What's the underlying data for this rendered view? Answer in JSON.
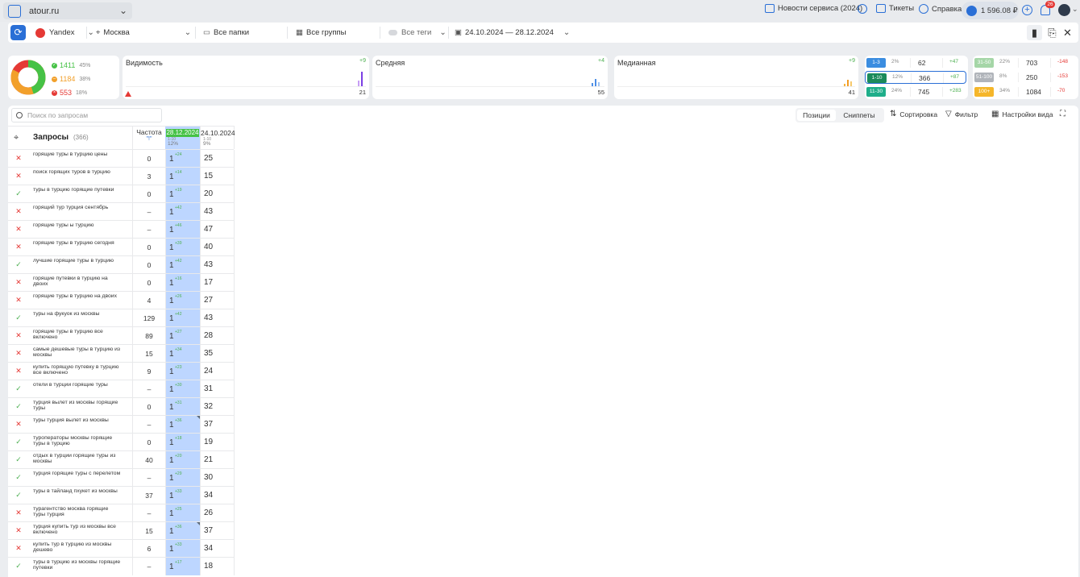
{
  "topbar": {
    "project": "atour.ru",
    "news": "Новости сервиса (2024)",
    "tickets": "Тикеты",
    "help": "Справка",
    "balance": "1 596.08 ₽",
    "notifications": "26"
  },
  "filters": {
    "engine": "Yandex",
    "region": "Москва",
    "folders": "Все папки",
    "groups": "Все группы",
    "tags": "Все теги",
    "dates": "24.10.2024 — 28.12.2024"
  },
  "summary": {
    "top": {
      "count": "1411",
      "pct": "45%"
    },
    "mid": {
      "count": "1184",
      "pct": "38%"
    },
    "low": {
      "count": "553",
      "pct": "18%"
    }
  },
  "metrics": [
    {
      "title": "Видимость",
      "delta": "+9",
      "value": "21"
    },
    {
      "title": "Средняя",
      "delta": "+4",
      "value": "55"
    },
    {
      "title": "Медианная",
      "delta": "+9",
      "value": "41"
    }
  ],
  "ranges": [
    {
      "label": "1-3",
      "pct": "2%",
      "value": "62",
      "delta": "+47",
      "color": "#3b8de0",
      "dcolor": "#4caf50"
    },
    {
      "label": "1-10",
      "pct": "12%",
      "value": "366",
      "delta": "+87",
      "color": "#1b8a5a",
      "dcolor": "#4caf50"
    },
    {
      "label": "11-30",
      "pct": "24%",
      "value": "745",
      "delta": "+283",
      "color": "#1fae8a",
      "dcolor": "#4caf50"
    },
    {
      "label": "31-50",
      "pct": "22%",
      "value": "703",
      "delta": "-148",
      "color": "#a5d6a7",
      "dcolor": "#e53935"
    },
    {
      "label": "51-100",
      "pct": "8%",
      "value": "250",
      "delta": "-153",
      "color": "#b0b4ba",
      "dcolor": "#e53935"
    },
    {
      "label": "100+",
      "pct": "34%",
      "value": "1084",
      "delta": "-70",
      "color": "#f5b62a",
      "dcolor": "#e53935"
    }
  ],
  "panel": {
    "search_placeholder": "Поиск по запросам",
    "tab_positions": "Позиции",
    "tab_snippets": "Сниппеты",
    "sort": "Сортировка",
    "filter": "Фильтр",
    "view": "Настройки вида",
    "queries_title": "Запросы",
    "queries_count": "(366)",
    "freq_title": "Частота",
    "freq_sub": "\"!\"",
    "date1": "28.12.2024",
    "date1_range": "1-10",
    "date1_pct": "12%",
    "date2": "24.10.2024",
    "date2_range": "1-10",
    "date2_pct": "9%"
  },
  "rows": [
    {
      "q": "горящие туры в турцию цены",
      "status": "x",
      "freq": "0",
      "pos": "1",
      "ch": "+24",
      "prev": "25"
    },
    {
      "q": "поиск горящих туров в турцию",
      "status": "x",
      "freq": "3",
      "pos": "1",
      "ch": "+14",
      "prev": "15"
    },
    {
      "q": "туры в турцию горящие путевки",
      "status": "ok",
      "freq": "0",
      "pos": "1",
      "ch": "+19",
      "prev": "20"
    },
    {
      "q": "горящий тур турция сентябрь",
      "status": "x",
      "freq": "–",
      "pos": "1",
      "ch": "+42",
      "prev": "43"
    },
    {
      "q": "горящие туры ы турцию",
      "status": "x",
      "freq": "–",
      "pos": "1",
      "ch": "+46",
      "prev": "47"
    },
    {
      "q": "горящие туры в турцию сегодня",
      "status": "x",
      "freq": "0",
      "pos": "1",
      "ch": "+39",
      "prev": "40"
    },
    {
      "q": "лучшие горящие туры в турцию",
      "status": "ok",
      "freq": "0",
      "pos": "1",
      "ch": "+42",
      "prev": "43"
    },
    {
      "q": "горящие путевки в турцию на двоих",
      "status": "x",
      "freq": "0",
      "pos": "1",
      "ch": "+16",
      "prev": "17"
    },
    {
      "q": "горящие туры в турцию на двоих",
      "status": "x",
      "freq": "4",
      "pos": "1",
      "ch": "+26",
      "prev": "27"
    },
    {
      "q": "туры на фукуок из москвы",
      "status": "ok",
      "freq": "129",
      "pos": "1",
      "ch": "+42",
      "prev": "43"
    },
    {
      "q": "горящие туры в турцию все включено",
      "status": "x",
      "freq": "89",
      "pos": "1",
      "ch": "+27",
      "prev": "28"
    },
    {
      "q": "самые дешевые туры в турцию из москвы",
      "status": "x",
      "freq": "15",
      "pos": "1",
      "ch": "+34",
      "prev": "35"
    },
    {
      "q": "купить горящую путевку в турцию все включено",
      "status": "x",
      "freq": "9",
      "pos": "1",
      "ch": "+23",
      "prev": "24"
    },
    {
      "q": "отели в турции горящие туры",
      "status": "ok",
      "freq": "–",
      "pos": "1",
      "ch": "+30",
      "prev": "31"
    },
    {
      "q": "турция вылет из москвы горящие туры",
      "status": "ok",
      "freq": "0",
      "pos": "1",
      "ch": "+31",
      "prev": "32"
    },
    {
      "q": "туры турция вылет из москвы",
      "status": "x",
      "freq": "–",
      "pos": "1",
      "ch": "+36",
      "prev": "37"
    },
    {
      "q": "туроператоры москвы горящие туры в турцию",
      "status": "ok",
      "freq": "0",
      "pos": "1",
      "ch": "+18",
      "prev": "19"
    },
    {
      "q": "отдых в турции горящие туры из москвы",
      "status": "ok",
      "freq": "40",
      "pos": "1",
      "ch": "+20",
      "prev": "21"
    },
    {
      "q": "турция горящие туры с перелетом",
      "status": "ok",
      "freq": "–",
      "pos": "1",
      "ch": "+29",
      "prev": "30"
    },
    {
      "q": "туры в тайланд пхукет из москвы",
      "status": "ok",
      "freq": "37",
      "pos": "1",
      "ch": "+33",
      "prev": "34"
    },
    {
      "q": "турагентство москва горящие туры турция",
      "status": "x",
      "freq": "–",
      "pos": "1",
      "ch": "+25",
      "prev": "26"
    },
    {
      "q": "турция купить тур из москвы все включено",
      "status": "x",
      "freq": "15",
      "pos": "1",
      "ch": "+36",
      "prev": "37"
    },
    {
      "q": "купить тур в турцию из москвы дешево",
      "status": "x",
      "freq": "6",
      "pos": "1",
      "ch": "+33",
      "prev": "34"
    },
    {
      "q": "туры в турцию из москвы горящие путевки",
      "status": "ok",
      "freq": "–",
      "pos": "1",
      "ch": "+17",
      "prev": "18"
    }
  ]
}
